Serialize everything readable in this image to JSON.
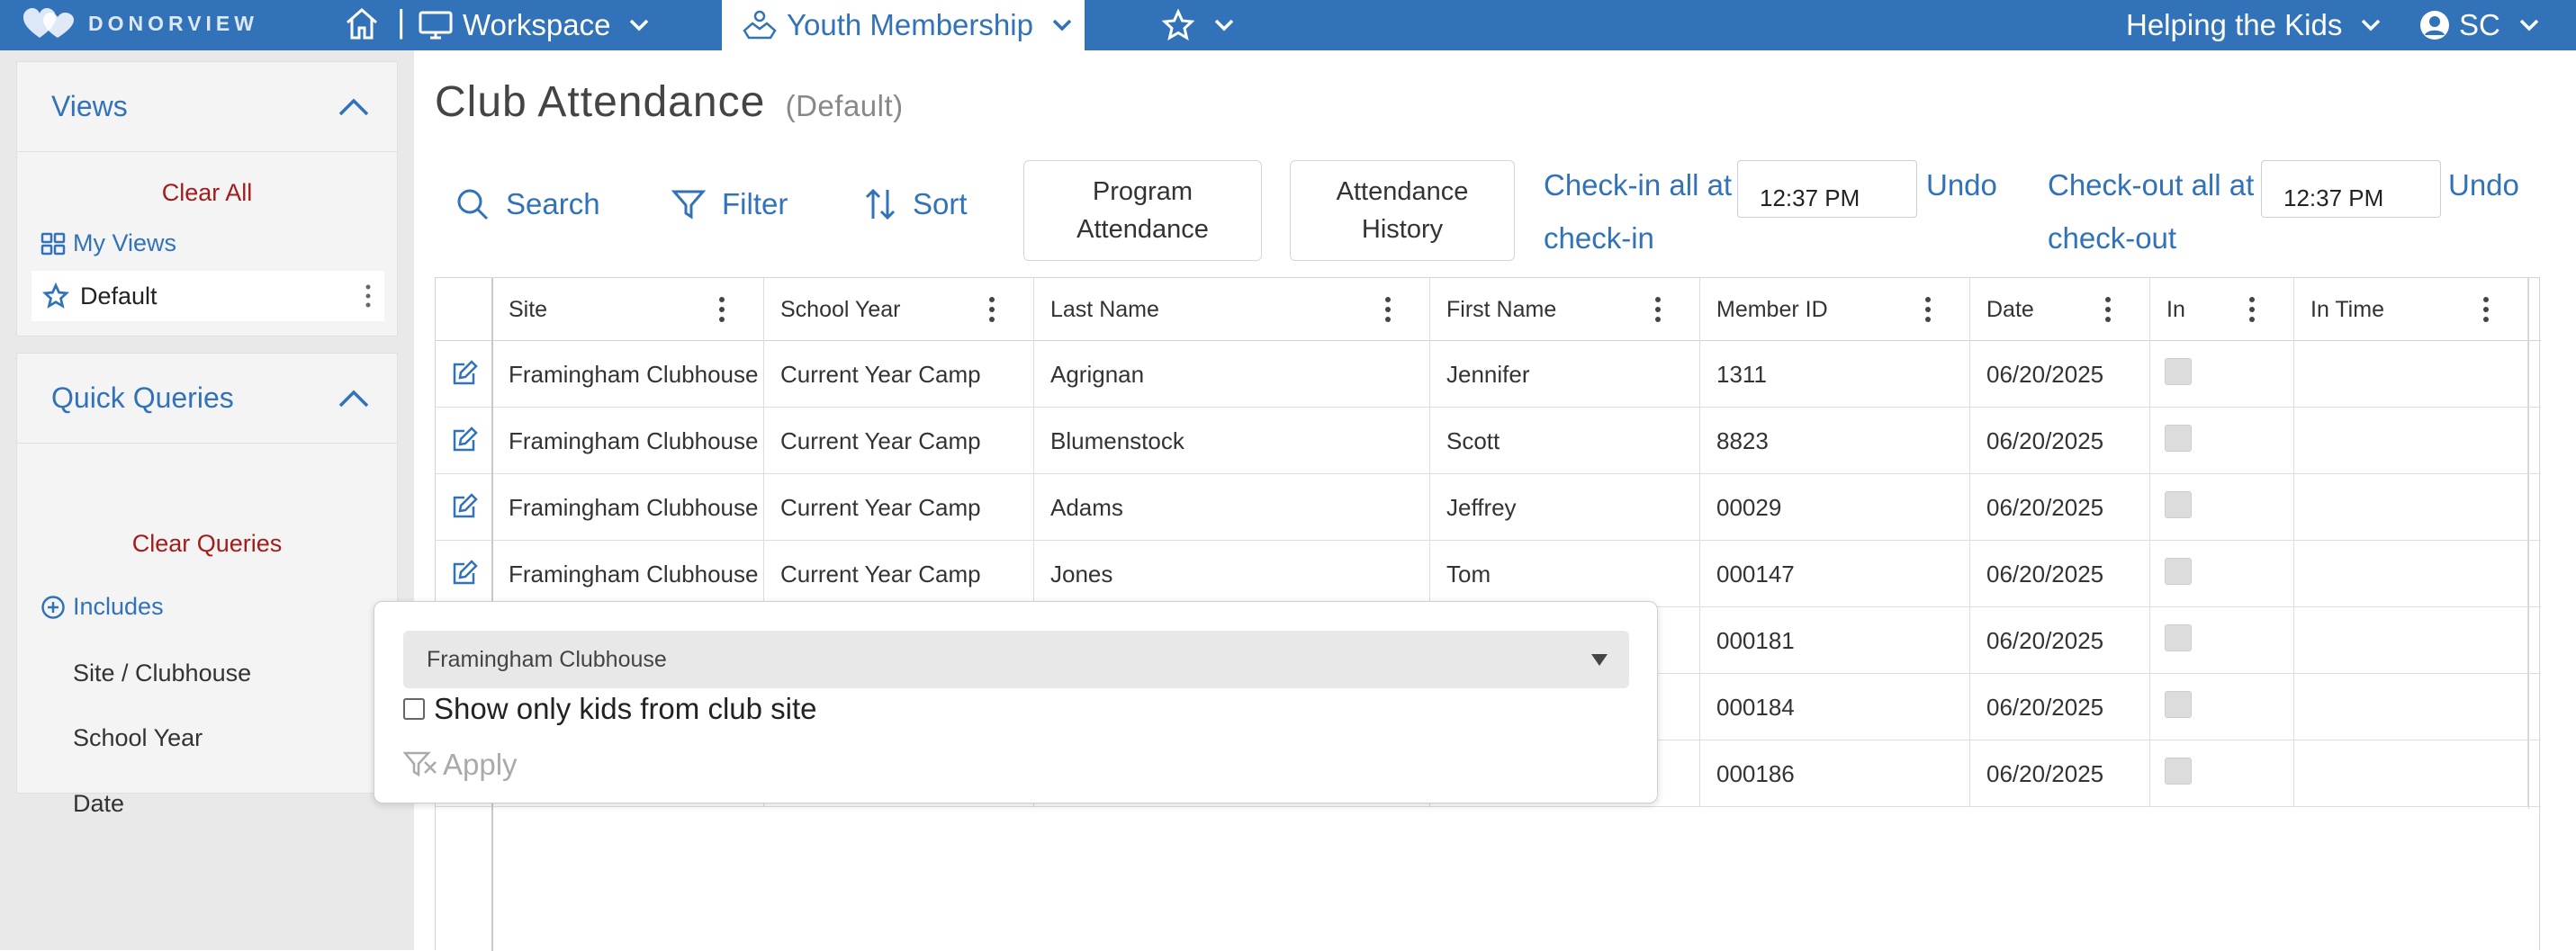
{
  "topbar": {
    "brand": "DONORVIEW",
    "workspace_label": "Workspace",
    "module_label": "Youth Membership",
    "org_label": "Helping the Kids",
    "user_initials": "SC",
    "bg_color": "#3172b8"
  },
  "sidebar": {
    "views": {
      "title": "Views",
      "clear_label": "Clear All",
      "my_views_label": "My Views",
      "default_label": "Default"
    },
    "queries": {
      "title": "Quick Queries",
      "clear_label": "Clear Queries",
      "includes_label": "Includes",
      "items": [
        "Site / Clubhouse",
        "School Year",
        "Date"
      ]
    }
  },
  "page": {
    "title": "Club Attendance",
    "subtitle": "(Default)"
  },
  "toolbar": {
    "search_label": "Search",
    "filter_label": "Filter",
    "sort_label": "Sort",
    "program_attendance_line1": "Program",
    "program_attendance_line2": "Attendance",
    "attendance_history_line1": "Attendance",
    "attendance_history_line2": "History",
    "checkin_label": "Check-in all at",
    "checkin_time": "12:37 PM",
    "undo_checkin_line1": "Undo",
    "undo_checkin_line2": "check-in",
    "checkout_label": "Check-out all at",
    "checkout_time": "12:37 PM",
    "undo_checkout_line1": "Undo",
    "undo_checkout_line2": "check-out"
  },
  "grid": {
    "columns": [
      "Site",
      "School Year",
      "Last Name",
      "First Name",
      "Member ID",
      "Date",
      "In",
      "In Time"
    ],
    "rows": [
      {
        "site": "Framingham Clubhouse",
        "school_year": "Current Year Camp",
        "last_name": "Agrignan",
        "first_name": "Jennifer",
        "member_id": "1311",
        "date": "06/20/2025"
      },
      {
        "site": "Framingham Clubhouse",
        "school_year": "Current Year Camp",
        "last_name": "Blumenstock",
        "first_name": "Scott",
        "member_id": "8823",
        "date": "06/20/2025"
      },
      {
        "site": "Framingham Clubhouse",
        "school_year": "Current Year Camp",
        "last_name": "Adams",
        "first_name": "Jeffrey",
        "member_id": "00029",
        "date": "06/20/2025"
      },
      {
        "site": "Framingham Clubhouse",
        "school_year": "Current Year Camp",
        "last_name": "Jones",
        "first_name": "Tom",
        "member_id": "000147",
        "date": "06/20/2025"
      },
      {
        "site": "",
        "school_year": "",
        "last_name": "",
        "first_name": "",
        "member_id": "000181",
        "date": "06/20/2025"
      },
      {
        "site": "",
        "school_year": "",
        "last_name": "",
        "first_name": "",
        "member_id": "000184",
        "date": "06/20/2025"
      },
      {
        "site": "",
        "school_year": "",
        "last_name": "",
        "first_name": "",
        "member_id": "000186",
        "date": "06/20/2025"
      }
    ]
  },
  "popover": {
    "selected_site": "Framingham Clubhouse",
    "checkbox_label": "Show only kids from club site",
    "apply_label": "Apply"
  }
}
